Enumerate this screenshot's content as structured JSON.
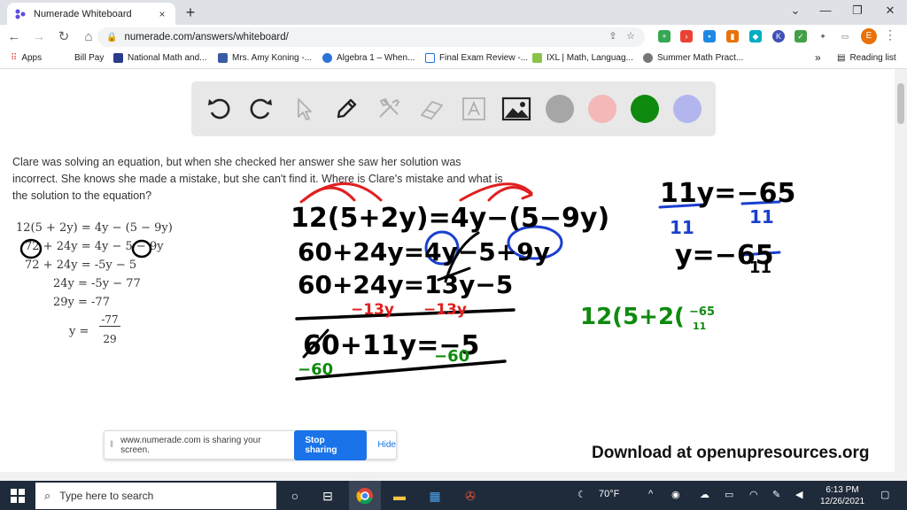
{
  "browser": {
    "tab_title": "Numerade Whiteboard",
    "tab_close": "×",
    "new_tab": "+",
    "url": "numerade.com/answers/whiteboard/",
    "avatar_letter": "E"
  },
  "bookmarks": [
    {
      "label": "Apps",
      "color": "#e8453c"
    },
    {
      "label": "Bill Pay",
      "color": "#ffffff"
    },
    {
      "label": "National Math and...",
      "color": "#2a3a8c"
    },
    {
      "label": "Mrs. Amy Koning -...",
      "color": "#3b5ba8"
    },
    {
      "label": "Algebra 1 – When...",
      "color": "#2a73d8"
    },
    {
      "label": "Final Exam Review -...",
      "color": "#1a73e8"
    },
    {
      "label": "IXL | Math, Languag...",
      "color": "#8bc34a"
    },
    {
      "label": "Summer Math Pract...",
      "color": "#777777"
    }
  ],
  "bookmarks_more": "»",
  "reading_list": "Reading list",
  "whiteboard": {
    "tools": [
      "undo-icon",
      "redo-icon",
      "pointer-icon",
      "pen-icon",
      "tools-icon",
      "eraser-icon",
      "text-icon",
      "image-icon"
    ],
    "colors": [
      "#a6a6a6",
      "#f4b8b8",
      "#0e8a0e",
      "#b3b6ee"
    ]
  },
  "problem": {
    "text": "Clare was solving an equation, but when she checked her answer she saw her solution was incorrect. She knows she made a mistake, but she can't find it. Where is Clare's mistake and what is the solution to the equation?",
    "steps": [
      "12(5 + 2y) = 4y − (5 − 9y)",
      "72 + 24y = 4y − 5 − 9y",
      "72 + 24y = -5y − 5",
      "24y = -5y − 77",
      "29y = -77",
      "y ="
    ],
    "fraction_num": "-77",
    "fraction_den": "29"
  },
  "share_bar": {
    "message": "www.numerade.com is sharing your screen.",
    "stop_label": "Stop sharing",
    "hide_label": "Hide"
  },
  "download_text": "Download at openupresources.org",
  "taskbar": {
    "search_placeholder": "Type here to search",
    "weather": "70°F",
    "time": "6:13 PM",
    "date": "12/26/2021"
  }
}
